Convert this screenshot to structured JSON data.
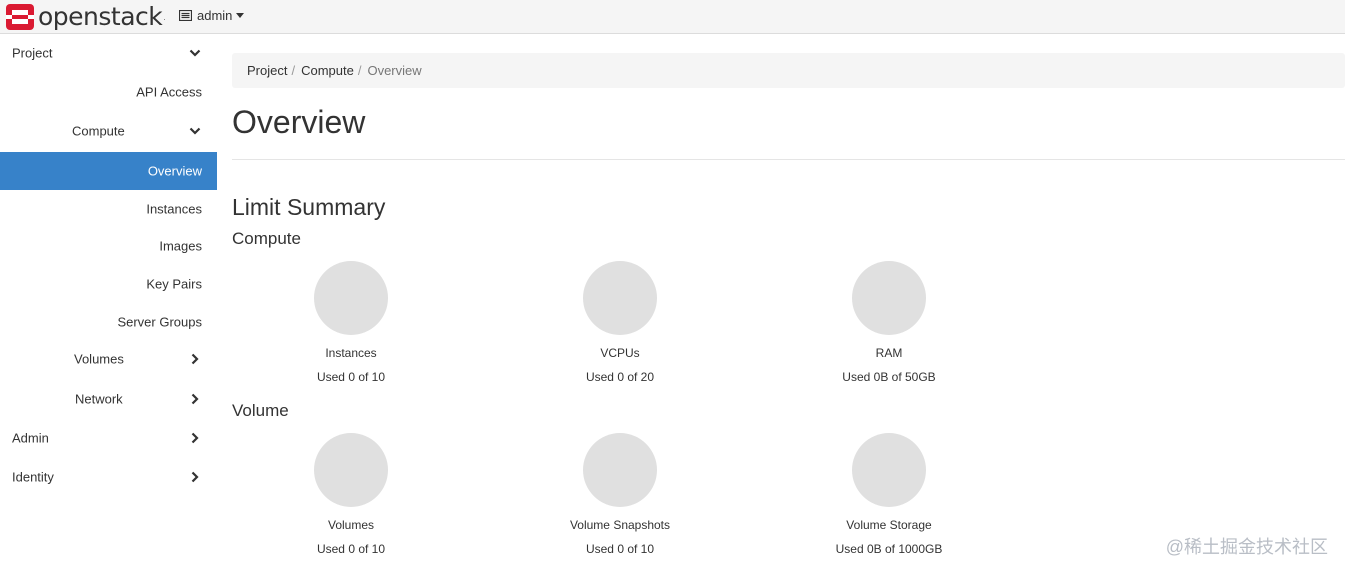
{
  "navbar": {
    "brand": "openstack",
    "trademark": ".",
    "project": "admin"
  },
  "sidebar": {
    "items": [
      {
        "label": "Project",
        "level": 0,
        "chevron": "down"
      },
      {
        "label": "API Access",
        "level": 2
      },
      {
        "label": "Compute",
        "level": 1,
        "chevron": "down"
      },
      {
        "label": "Overview",
        "level": 2,
        "active": true
      },
      {
        "label": "Instances",
        "level": 2
      },
      {
        "label": "Images",
        "level": 2
      },
      {
        "label": "Key Pairs",
        "level": 2
      },
      {
        "label": "Server Groups",
        "level": 2
      },
      {
        "label": "Volumes",
        "level": 1,
        "chevron": "right"
      },
      {
        "label": "Network",
        "level": 1,
        "chevron": "right"
      },
      {
        "label": "Admin",
        "level": 0,
        "chevron": "right"
      },
      {
        "label": "Identity",
        "level": 0,
        "chevron": "right"
      }
    ]
  },
  "breadcrumb": [
    "Project",
    "Compute",
    "Overview"
  ],
  "page_title": "Overview",
  "limit_summary": {
    "title": "Limit Summary",
    "groups": [
      {
        "title": "Compute",
        "charts": [
          {
            "label": "Instances",
            "used": "Used 0 of 10"
          },
          {
            "label": "VCPUs",
            "used": "Used 0 of 20"
          },
          {
            "label": "RAM",
            "used": "Used 0B of 50GB"
          }
        ]
      },
      {
        "title": "Volume",
        "charts": [
          {
            "label": "Volumes",
            "used": "Used 0 of 10"
          },
          {
            "label": "Volume Snapshots",
            "used": "Used 0 of 10"
          },
          {
            "label": "Volume Storage",
            "used": "Used 0B of 1000GB"
          }
        ]
      }
    ]
  },
  "watermark": "@稀土掘金技术社区",
  "colors": {
    "active": "#3782c9",
    "logo": "#da1a32",
    "pie": "#e0e0e0"
  }
}
